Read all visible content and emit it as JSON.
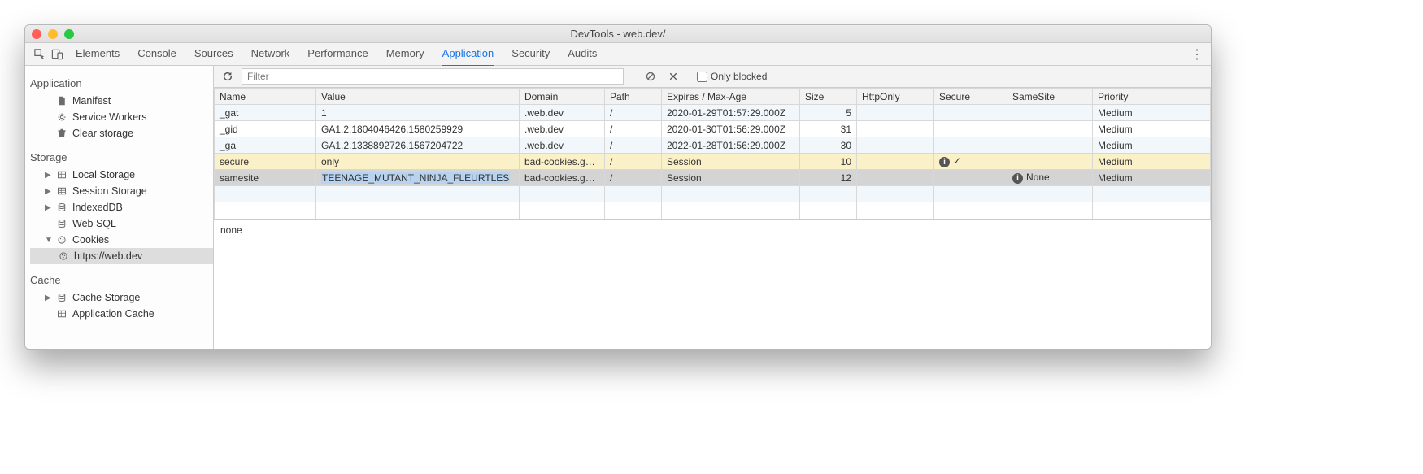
{
  "window": {
    "title": "DevTools - web.dev/"
  },
  "tabbar": {
    "tabs": [
      "Elements",
      "Console",
      "Sources",
      "Network",
      "Performance",
      "Memory",
      "Application",
      "Security",
      "Audits"
    ],
    "active": "Application"
  },
  "sidebar": {
    "groups": [
      {
        "title": "Application",
        "items": [
          {
            "label": "Manifest",
            "icon": "file"
          },
          {
            "label": "Service Workers",
            "icon": "gear"
          },
          {
            "label": "Clear storage",
            "icon": "trash"
          }
        ]
      },
      {
        "title": "Storage",
        "items": [
          {
            "label": "Local Storage",
            "icon": "db-grid",
            "expandable": true
          },
          {
            "label": "Session Storage",
            "icon": "db-grid",
            "expandable": true
          },
          {
            "label": "IndexedDB",
            "icon": "db",
            "expandable": true
          },
          {
            "label": "Web SQL",
            "icon": "db"
          },
          {
            "label": "Cookies",
            "icon": "cookie",
            "expandable": true,
            "expanded": true,
            "children": [
              {
                "label": "https://web.dev",
                "icon": "cookie",
                "selected": true
              }
            ]
          }
        ]
      },
      {
        "title": "Cache",
        "items": [
          {
            "label": "Cache Storage",
            "icon": "db",
            "expandable": true
          },
          {
            "label": "Application Cache",
            "icon": "db-grid"
          }
        ]
      }
    ]
  },
  "toolbar": {
    "filter_placeholder": "Filter",
    "only_blocked_label": "Only blocked"
  },
  "table": {
    "columns": [
      "Name",
      "Value",
      "Domain",
      "Path",
      "Expires / Max-Age",
      "Size",
      "HttpOnly",
      "Secure",
      "SameSite",
      "Priority"
    ],
    "rows": [
      {
        "name": "_gat",
        "value": "1",
        "domain": ".web.dev",
        "path": "/",
        "expires": "2020-01-29T01:57:29.000Z",
        "size": "5",
        "httponly": "",
        "secure": "",
        "samesite": "",
        "priority": "Medium",
        "style": "alt"
      },
      {
        "name": "_gid",
        "value": "GA1.2.1804046426.1580259929",
        "domain": ".web.dev",
        "path": "/",
        "expires": "2020-01-30T01:56:29.000Z",
        "size": "31",
        "httponly": "",
        "secure": "",
        "samesite": "",
        "priority": "Medium",
        "style": ""
      },
      {
        "name": "_ga",
        "value": "GA1.2.1338892726.1567204722",
        "domain": ".web.dev",
        "path": "/",
        "expires": "2022-01-28T01:56:29.000Z",
        "size": "30",
        "httponly": "",
        "secure": "",
        "samesite": "",
        "priority": "Medium",
        "style": "alt"
      },
      {
        "name": "secure",
        "value": "only",
        "domain": "bad-cookies.g…",
        "path": "/",
        "expires": "Session",
        "size": "10",
        "httponly": "",
        "secure": "ⓘ ✓",
        "samesite": "",
        "priority": "Medium",
        "style": "warn"
      },
      {
        "name": "samesite",
        "value": "TEENAGE_MUTANT_NINJA_FLEURTLES",
        "domain": "bad-cookies.g…",
        "path": "/",
        "expires": "Session",
        "size": "12",
        "httponly": "",
        "secure": "",
        "samesite": "ⓘ None",
        "priority": "Medium",
        "style": "sel",
        "highlightValue": true
      }
    ]
  },
  "detail": {
    "text": "none"
  }
}
